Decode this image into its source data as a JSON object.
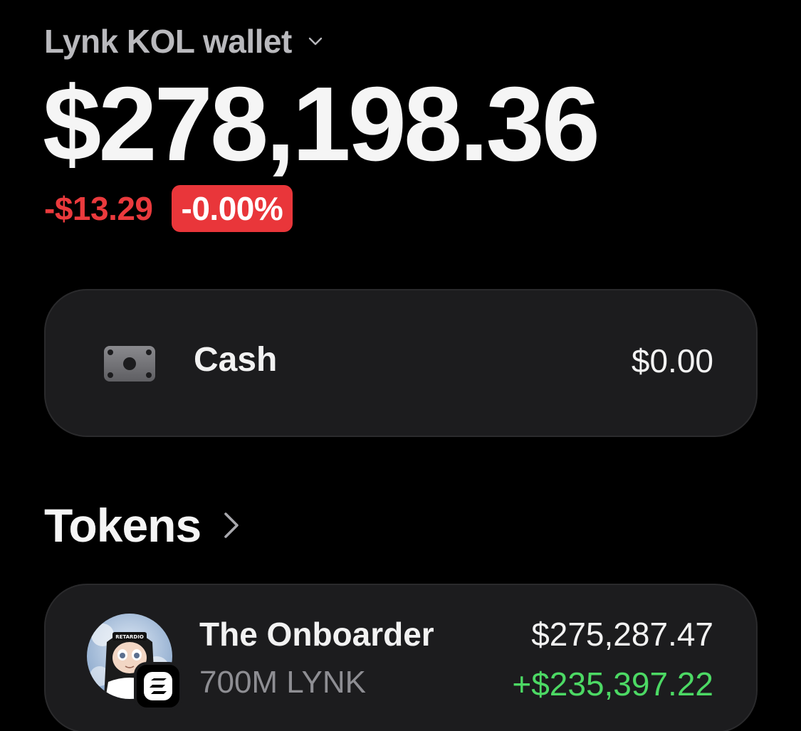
{
  "header": {
    "wallet_name": "Lynk KOL wallet"
  },
  "balance": {
    "total": "$278,198.36",
    "change_amount": "-$13.29",
    "change_percent": "-0.00%"
  },
  "cash": {
    "label": "Cash",
    "value": "$0.00",
    "icon": "cash-icon"
  },
  "tokens": {
    "title": "Tokens",
    "items": [
      {
        "name": "The Onboarder",
        "amount": "700M LYNK",
        "value": "$275,287.47",
        "change": "+$235,397.22",
        "avatar_text": "RETARDIO",
        "chain_icon": "solana-icon"
      }
    ]
  },
  "colors": {
    "negative": "#ea3a3d",
    "positive": "#4cd964",
    "card_bg": "#1c1c1e",
    "muted": "#8e8e93"
  }
}
